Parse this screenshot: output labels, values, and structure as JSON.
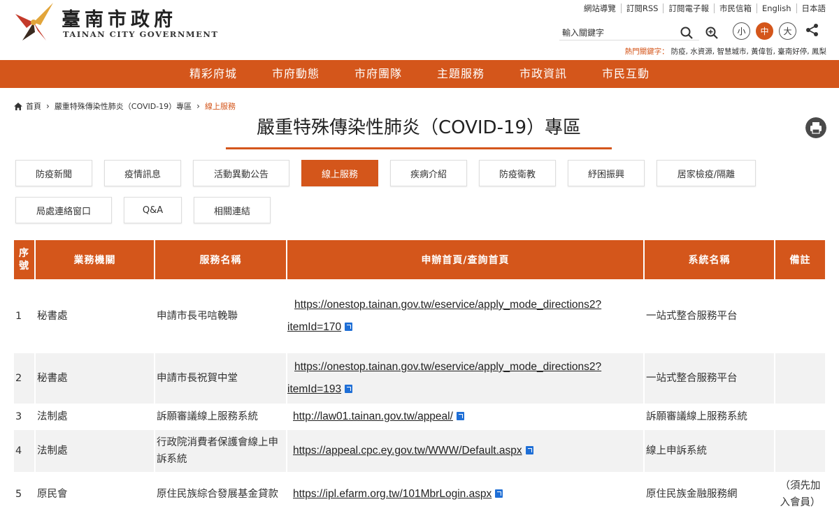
{
  "header": {
    "logo_cn": "臺南市政府",
    "logo_en": "TAINAN CITY GOVERNMENT",
    "top_links": [
      "網站導覽",
      "訂閱RSS",
      "訂閱電子報",
      "市民信箱",
      "English",
      "日本語"
    ],
    "search_placeholder": "輸入關鍵字",
    "font_sizes": [
      "小",
      "中",
      "大"
    ],
    "hot_label": "熱門關鍵字：",
    "hot_keywords": "防疫, 水資源, 智慧城市, 黃偉哲, 臺南好停, 鳳梨"
  },
  "nav": [
    "精彩府城",
    "市府動態",
    "市府團隊",
    "主題服務",
    "市政資訊",
    "市民互動"
  ],
  "breadcrumb": {
    "home": "首頁",
    "section": "嚴重特殊傳染性肺炎（COVID-19）專區",
    "current": "線上服務"
  },
  "page_title": "嚴重特殊傳染性肺炎（COVID-19）專區",
  "tabs": [
    "防疫新聞",
    "疫情訊息",
    "活動異動公告",
    "線上服務",
    "疾病介紹",
    "防疫衛教",
    "紓困振興",
    "居家檢疫/隔離",
    "局處連絡窗口",
    "Q&A",
    "相關連結"
  ],
  "active_tab": "線上服務",
  "table": {
    "headers": [
      "序號",
      "業務機關",
      "服務名稱",
      "申辦首頁/查詢首頁",
      "系統名稱",
      "備註"
    ],
    "rows": [
      {
        "seq": "1",
        "agency": "秘書處",
        "service": "申請市長弔唁輓聯",
        "url1": "https://onestop.tainan.gov.tw/eservice/apply_mode_directions2?",
        "url2": "itemId=170",
        "system": "一站式整合服務平台",
        "note": ""
      },
      {
        "seq": "2",
        "agency": "秘書處",
        "service": "申請市長祝賀中堂",
        "url1": "https://onestop.tainan.gov.tw/eservice/apply_mode_directions2?",
        "url2": "itemId=193",
        "system": "一站式整合服務平台",
        "note": ""
      },
      {
        "seq": "3",
        "agency": "法制處",
        "service": "訴願審議線上服務系統",
        "url1": "http://law01.tainan.gov.tw/appeal/",
        "url2": "",
        "system": "訴願審議線上服務系統",
        "note": ""
      },
      {
        "seq": "4",
        "agency": "法制處",
        "service": "行政院消費者保護會線上申訴系統",
        "url1": "https://appeal.cpc.ey.gov.tw/WWW/Default.aspx",
        "url2": "",
        "system": "線上申訴系統",
        "note": ""
      },
      {
        "seq": "5",
        "agency": "原民會",
        "service": "原住民族綜合發展基金貸款",
        "url1": "https://ipl.efarm.org.tw/101MbrLogin.aspx",
        "url2": "",
        "system": "原住民族金融服務網",
        "note": "（須先加入會員）"
      }
    ]
  },
  "colors": {
    "accent": "#d4561b",
    "row_alt": "#f2f2f2",
    "link_icon": "#1f6fd6"
  }
}
